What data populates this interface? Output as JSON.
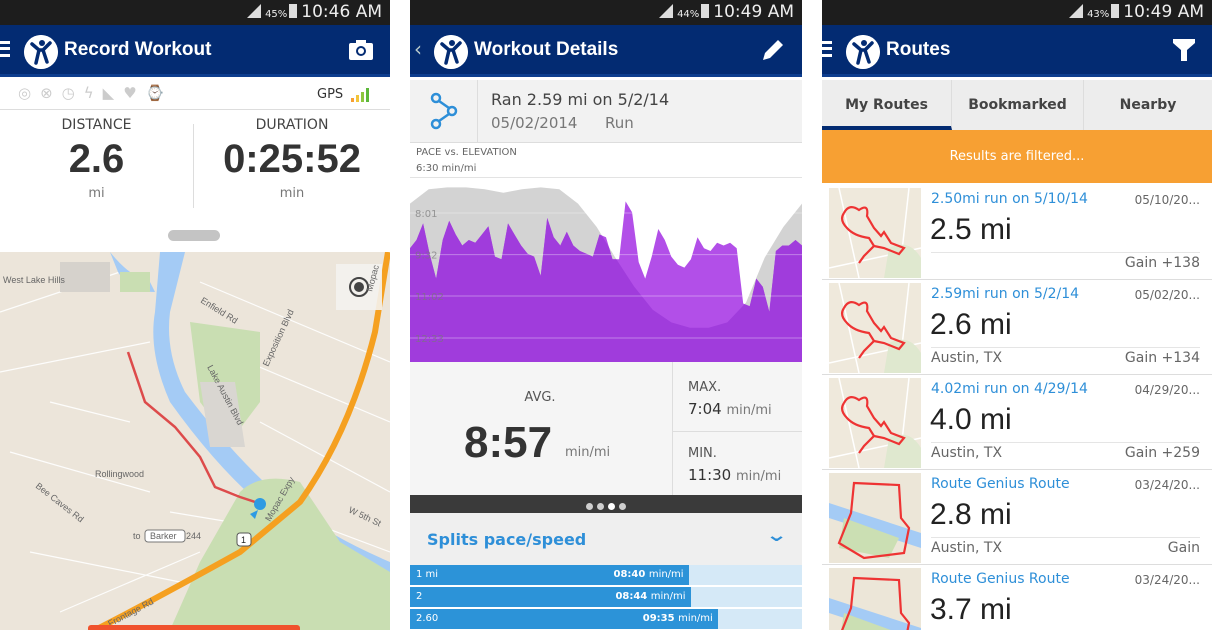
{
  "colors": {
    "appbar": "#032b72",
    "accent_blue": "#2e8fd8",
    "pace_purple": "#a43fdd",
    "orange": "#f7a033",
    "route_red": "#e04040"
  },
  "screen1": {
    "status": {
      "battery": "45%",
      "time": "10:46 AM"
    },
    "title": "Record Workout",
    "action_icon": "camera-icon",
    "sensor_icons": [
      "heart-rate-sensor-icon",
      "cadence-icon",
      "stopwatch-icon",
      "power-icon",
      "shoe-icon",
      "heart-icon",
      "watch-icon"
    ],
    "gps_label": "GPS",
    "distance": {
      "label": "DISTANCE",
      "value": "2.6",
      "unit": "mi"
    },
    "duration": {
      "label": "DURATION",
      "value": "0:25:52",
      "unit": "min"
    },
    "map": {
      "labels": [
        "West Lake Hills",
        "Enfield Rd",
        "Exposition Blvd",
        "Lake Austin Blvd",
        "Mopac Expy",
        "Rollingwood",
        "Bee Caves Rd",
        "W 5th St",
        "to",
        "Barker",
        "244",
        "Frontage Rd",
        "1",
        "Mopac"
      ]
    }
  },
  "screen2": {
    "status": {
      "battery": "44%",
      "time": "10:49 AM"
    },
    "title": "Workout Details",
    "action_icon": "pencil-icon",
    "workout": {
      "name": "Ran 2.59 mi on 5/2/14",
      "date": "05/02/2014",
      "type": "Run"
    },
    "avg": {
      "label": "AVG.",
      "value": "8:57",
      "unit": "min/mi"
    },
    "max": {
      "label": "MAX.",
      "value": "7:04",
      "unit": "min/mi"
    },
    "min": {
      "label": "MIN.",
      "value": "11:30",
      "unit": "min/mi"
    },
    "pager": {
      "pages": 4,
      "active": 3
    },
    "splits_title": "Splits pace/speed",
    "splits": [
      {
        "label": "1 mi",
        "pace": "08:40",
        "unit": "min/mi",
        "minutes": 8.67
      },
      {
        "label": "2",
        "pace": "08:44",
        "unit": "min/mi",
        "minutes": 8.73
      },
      {
        "label": "2.60",
        "pace": "09:35",
        "unit": "min/mi",
        "minutes": 9.58
      }
    ]
  },
  "chart_data": {
    "type": "area",
    "title": "PACE vs. ELEVATION",
    "ylabel": "6:30 min/mi",
    "y_ticks": [
      "8:01",
      "9:32",
      "11:02",
      "12:33"
    ],
    "y_tick_values": [
      8.02,
      9.53,
      11.03,
      12.55
    ],
    "ylim": [
      6.5,
      13.2
    ],
    "y_inverted": true,
    "grid": true,
    "series": [
      {
        "values": [
          9.3,
          9.0,
          8.4,
          9.5,
          10.4,
          9.0,
          8.3,
          8.8,
          9.2,
          9.0,
          9.1,
          8.8,
          8.5,
          9.6,
          9.7,
          8.4,
          8.8,
          9.2,
          9.5,
          9.6,
          10.3,
          8.2,
          8.9,
          9.2,
          8.7,
          9.2,
          9.4,
          9.5,
          9.6,
          8.8,
          8.9,
          9.7,
          9.7,
          7.6,
          8.0,
          9.8,
          10.4,
          9.6,
          8.6,
          9.0,
          9.6,
          9.9,
          10.0,
          9.7,
          8.9,
          9.3,
          9.4,
          9.1,
          9.2,
          9.1,
          9.3,
          11.3,
          11.4,
          10.4,
          10.7,
          11.6,
          9.4,
          9.2,
          9.2,
          9.0,
          9.2
        ]
      },
      {
        "values_relative": [
          88,
          96,
          97,
          97,
          96,
          94,
          96,
          97,
          96,
          88,
          75,
          58,
          42,
          29,
          22,
          19,
          19,
          22,
          33,
          58,
          75,
          88
        ]
      }
    ]
  },
  "screen3": {
    "status": {
      "battery": "43%",
      "time": "10:49 AM"
    },
    "title": "Routes",
    "action_icon": "filter-icon",
    "tabs": [
      {
        "label": "My Routes",
        "active": true
      },
      {
        "label": "Bookmarked"
      },
      {
        "label": "Nearby"
      }
    ],
    "banner": "Results are filtered...",
    "routes": [
      {
        "name": "2.50mi run on 5/10/14",
        "date": "05/10/20...",
        "distance": "2.5 mi",
        "location": "",
        "gain": "Gain +138",
        "thumb": "park"
      },
      {
        "name": "2.59mi run on 5/2/14",
        "date": "05/02/20...",
        "distance": "2.6 mi",
        "location": "Austin, TX",
        "gain": "Gain +134",
        "thumb": "park"
      },
      {
        "name": "4.02mi run on 4/29/14",
        "date": "04/29/20...",
        "distance": "4.0 mi",
        "location": "Austin, TX",
        "gain": "Gain +259",
        "thumb": "park"
      },
      {
        "name": "Route Genius Route",
        "date": "03/24/20...",
        "distance": "2.8 mi",
        "location": "Austin, TX",
        "gain": "Gain",
        "thumb": "river"
      },
      {
        "name": "Route Genius Route",
        "date": "03/24/20...",
        "distance": "3.7 mi",
        "location": "",
        "gain": "",
        "thumb": "river"
      }
    ]
  }
}
